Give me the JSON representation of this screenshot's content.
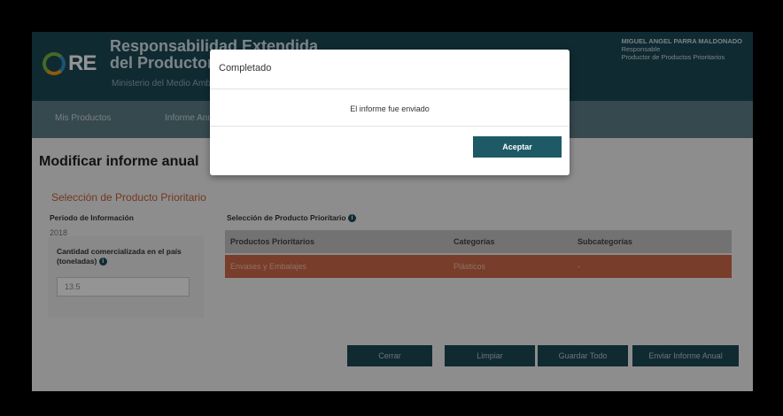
{
  "header": {
    "logo_text": "RE",
    "title_line1": "Responsabilidad Extendida",
    "title_line2": "del Productor",
    "subtitle": "Ministerio del Medio Ambiente",
    "user_name": "MIGUEL ANGEL PARRA MALDONADO",
    "user_role": "Responsable",
    "user_company": "Productor de Productos Prioritarios"
  },
  "nav": {
    "items": [
      "Mis Productos",
      "Informe Anual"
    ]
  },
  "page": {
    "title": "Modificar informe anual",
    "section_title": "Selección de Producto Prioritario",
    "period_label": "Periodo de Información",
    "period_value": "2018",
    "quantity_label": "Cantidad comercializada en el país (toneladas)",
    "quantity_value": "13.5",
    "table_label": "Selección de Producto Prioritario"
  },
  "table": {
    "headers": [
      "Productos Prioritarios",
      "Categorías",
      "Subcategorías"
    ],
    "rows": [
      [
        "Envases y Embalajes",
        "Plásticos",
        "-"
      ]
    ]
  },
  "actions": {
    "close": "Cerrar",
    "clear": "Limpiar",
    "save_all": "Guardar Todo",
    "send": "Enviar Informe Anual"
  },
  "modal": {
    "title": "Completado",
    "message": "El informe fue enviado",
    "ok": "Aceptar"
  },
  "colors": {
    "header_bg": "#1d4957",
    "accent_orange": "#c8603c",
    "button_bg": "#1d4957"
  }
}
